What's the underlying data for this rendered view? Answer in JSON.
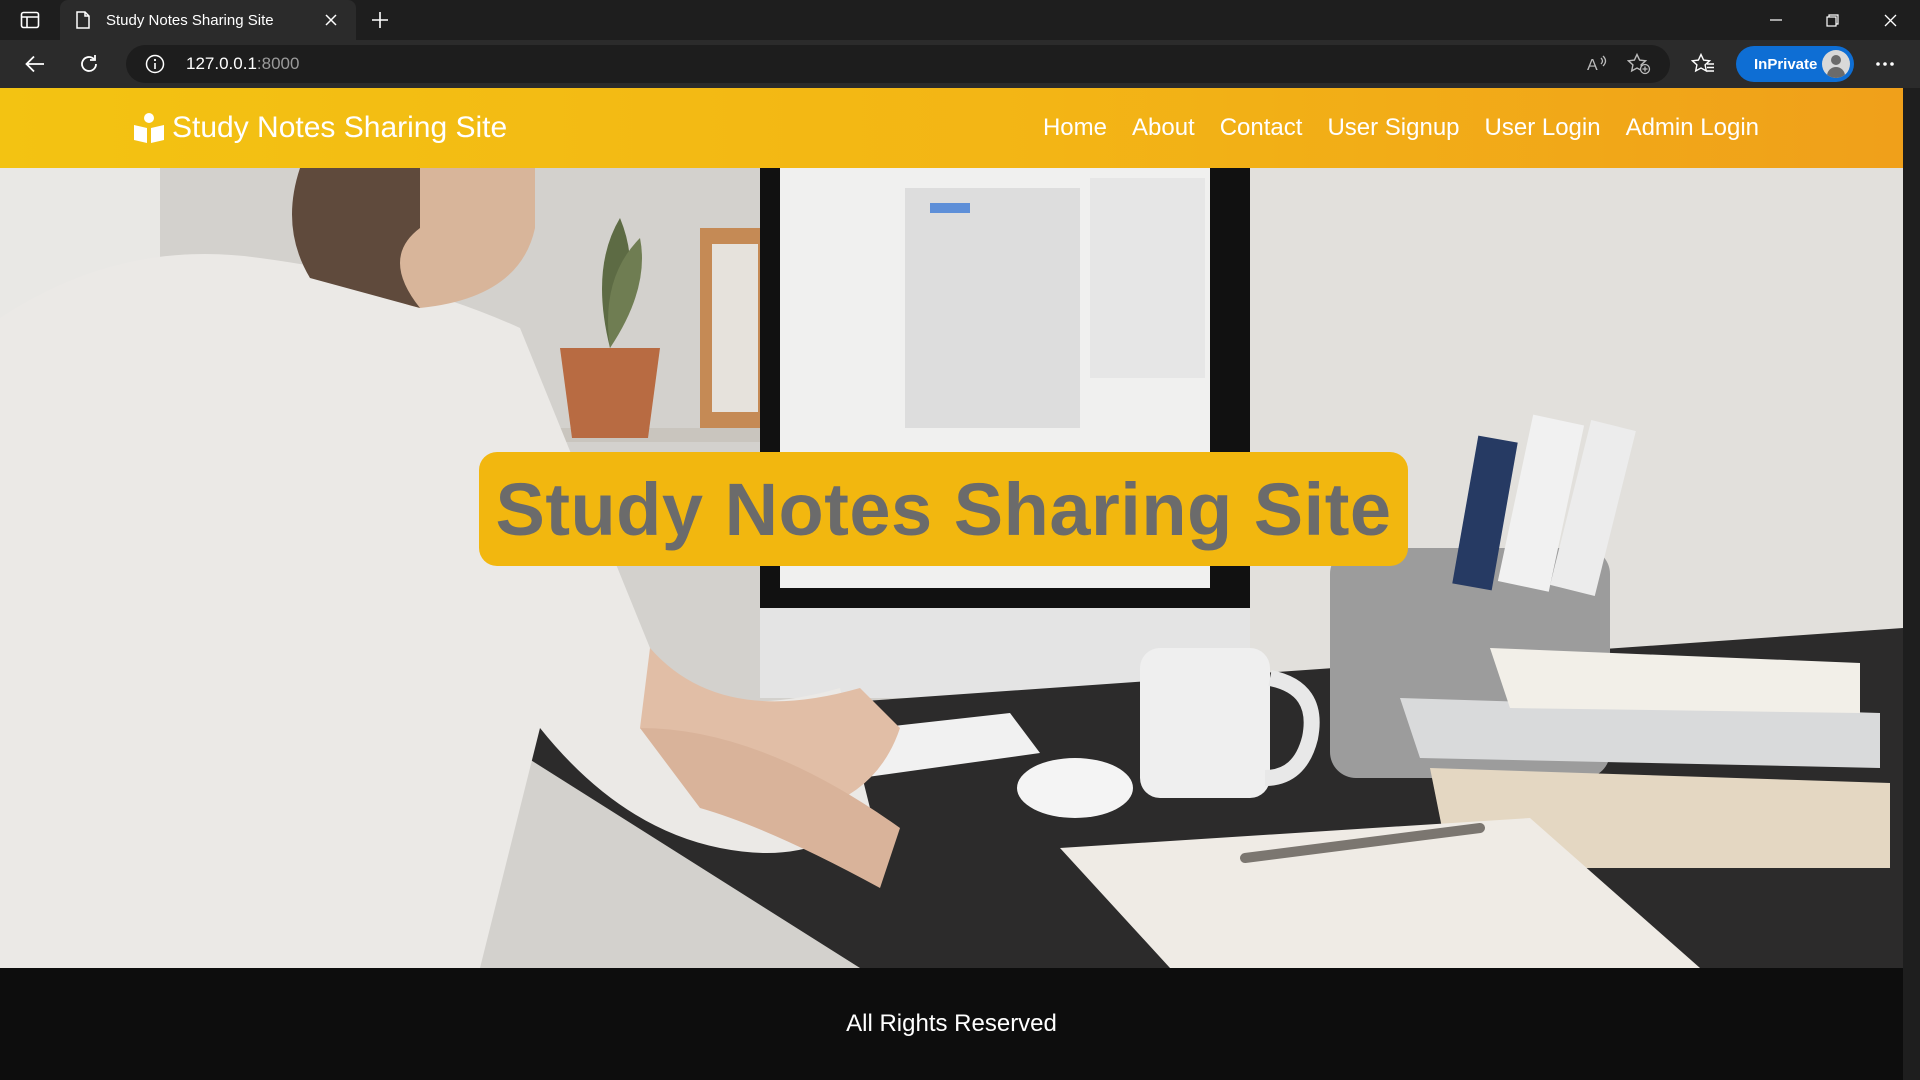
{
  "browser": {
    "tab_title": "Study Notes Sharing Site",
    "url_host": "127.0.0.1",
    "url_port": ":8000",
    "inprivate_label": "InPrivate"
  },
  "navbar": {
    "brand": "Study Notes Sharing Site",
    "links": [
      "Home",
      "About",
      "Contact",
      "User Signup",
      "User Login",
      "Admin Login"
    ]
  },
  "hero": {
    "title": "Study Notes Sharing Site"
  },
  "footer": {
    "text": "All Rights Reserved"
  },
  "colors": {
    "navbar_accent": "#f3b515",
    "hero_title_bg": "#f2b70f",
    "footer_bg": "#0d0d0d",
    "inprivate_bg": "#0e6ed4"
  }
}
